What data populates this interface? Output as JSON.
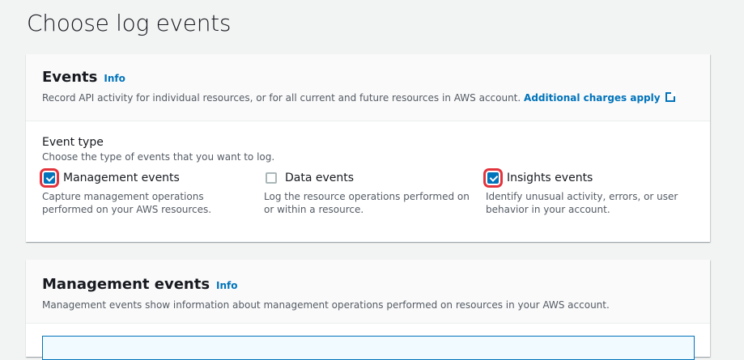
{
  "page_title": "Choose log events",
  "events": {
    "title": "Events",
    "info": "Info",
    "description": "Record API activity for individual resources, or for all current and future resources in AWS account.",
    "charges_link": "Additional charges apply",
    "event_type_label": "Event type",
    "event_type_desc": "Choose the type of events that you want to log.",
    "options": [
      {
        "label": "Management events",
        "checked": true,
        "description": "Capture management operations performed on your AWS resources."
      },
      {
        "label": "Data events",
        "checked": false,
        "description": "Log the resource operations performed on or within a resource."
      },
      {
        "label": "Insights events",
        "checked": true,
        "description": "Identify unusual activity, errors, or user behavior in your account."
      }
    ]
  },
  "management": {
    "title": "Management events",
    "info": "Info",
    "description": "Management events show information about management operations performed on resources in your AWS account."
  }
}
